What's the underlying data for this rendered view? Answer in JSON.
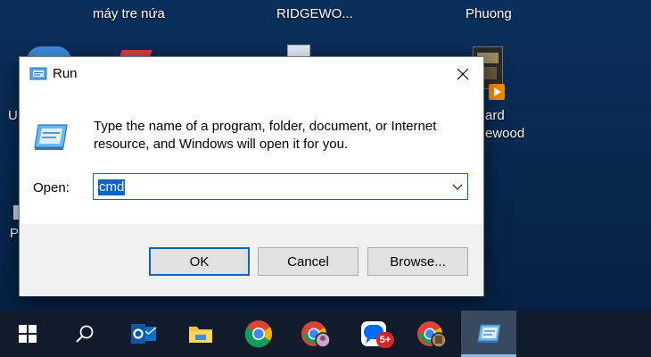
{
  "desktop": {
    "icons": [
      {
        "label_line1": "máy tre nứa"
      },
      {
        "label_line1": "RIDGEWO..."
      },
      {
        "label_line1": "Phuong"
      },
      {
        "label_line1": "U"
      },
      {
        "label_line1": "ard",
        "label_line2": "ewood"
      },
      {
        "label_line1": "P"
      }
    ]
  },
  "run_dialog": {
    "title": "Run",
    "description": "Type the name of a program, folder, document, or Internet resource, and Windows will open it for you.",
    "open_label": "Open:",
    "open_value": "cmd",
    "buttons": {
      "ok": "OK",
      "cancel": "Cancel",
      "browse": "Browse..."
    }
  },
  "taskbar": {
    "zalo_badge": "5+",
    "items": [
      "windows-start",
      "search",
      "outlook",
      "file-explorer",
      "chrome",
      "chrome-profile-1",
      "zalo",
      "chrome-profile-2",
      "run"
    ]
  },
  "colors": {
    "accent": "#0a64c8",
    "taskbar": "#101b2b",
    "desktop": "#0b2f5c",
    "button_face": "#e1e1e1",
    "button_area": "#f0f0f0",
    "badge": "#d7252a"
  }
}
